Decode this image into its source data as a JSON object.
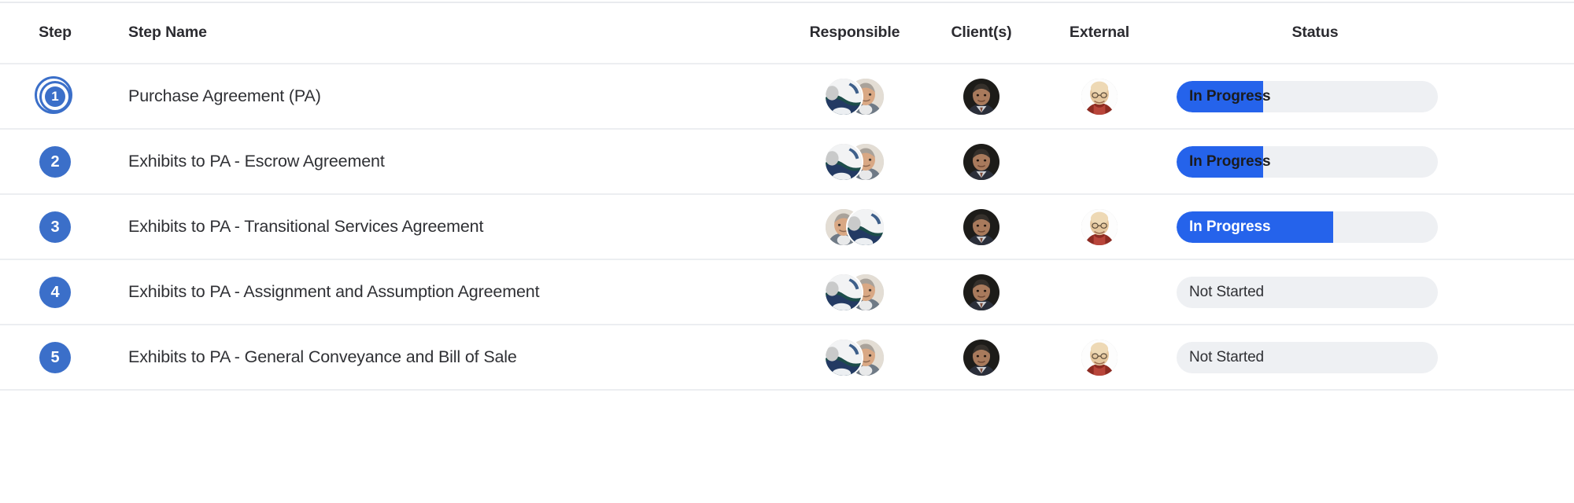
{
  "table": {
    "columns": [
      {
        "key": "step",
        "label": "Step"
      },
      {
        "key": "step_name",
        "label": "Step Name"
      },
      {
        "key": "responsible",
        "label": "Responsible"
      },
      {
        "key": "clients",
        "label": "Client(s)"
      },
      {
        "key": "external",
        "label": "External"
      },
      {
        "key": "status",
        "label": "Status"
      }
    ],
    "rows": [
      {
        "step": "1",
        "step_active": true,
        "step_name": "Purchase Agreement (PA)",
        "responsible_avatars": [
          "responsible-avatar-dark-suit",
          "responsible-avatar-grey-hair-man"
        ],
        "responsible_order": "fwd",
        "client_avatars": [
          "client-avatar-dark-portrait"
        ],
        "external_avatars": [
          "external-avatar-bald-elder"
        ],
        "status_label": "In Progress",
        "status_progress": 33,
        "status_text_style": "dark"
      },
      {
        "step": "2",
        "step_active": false,
        "step_name": "Exhibits to PA - Escrow Agreement",
        "responsible_avatars": [
          "responsible-avatar-dark-suit",
          "responsible-avatar-grey-hair-man"
        ],
        "responsible_order": "fwd",
        "client_avatars": [
          "client-avatar-dark-portrait"
        ],
        "external_avatars": [],
        "status_label": "In Progress",
        "status_progress": 33,
        "status_text_style": "dark"
      },
      {
        "step": "3",
        "step_active": false,
        "step_name": "Exhibits to PA - Transitional Services Agreement",
        "responsible_avatars": [
          "responsible-avatar-grey-hair-man",
          "responsible-avatar-dark-suit"
        ],
        "responsible_order": "rev",
        "client_avatars": [
          "client-avatar-dark-portrait"
        ],
        "external_avatars": [
          "external-avatar-bald-elder"
        ],
        "status_label": "In Progress",
        "status_progress": 60,
        "status_text_style": "light"
      },
      {
        "step": "4",
        "step_active": false,
        "step_name": "Exhibits to PA - Assignment and Assumption Agreement",
        "responsible_avatars": [
          "responsible-avatar-dark-suit",
          "responsible-avatar-grey-hair-man"
        ],
        "responsible_order": "fwd",
        "client_avatars": [
          "client-avatar-dark-portrait"
        ],
        "external_avatars": [],
        "status_label": "Not Started",
        "status_progress": 0,
        "status_text_style": "muted"
      },
      {
        "step": "5",
        "step_active": false,
        "step_name": "Exhibits to PA - General Conveyance and Bill of Sale",
        "responsible_avatars": [
          "responsible-avatar-dark-suit",
          "responsible-avatar-grey-hair-man"
        ],
        "responsible_order": "fwd",
        "client_avatars": [
          "client-avatar-dark-portrait"
        ],
        "external_avatars": [
          "external-avatar-bald-elder"
        ],
        "status_label": "Not Started",
        "status_progress": 0,
        "status_text_style": "muted"
      }
    ]
  },
  "colors": {
    "accent_blue": "#2563eb",
    "badge_blue": "#3b6fc9",
    "track_gray": "#eef0f3",
    "row_divider": "#eceef1",
    "text_dark": "#2f3034",
    "header_text": "#2b2b30"
  }
}
